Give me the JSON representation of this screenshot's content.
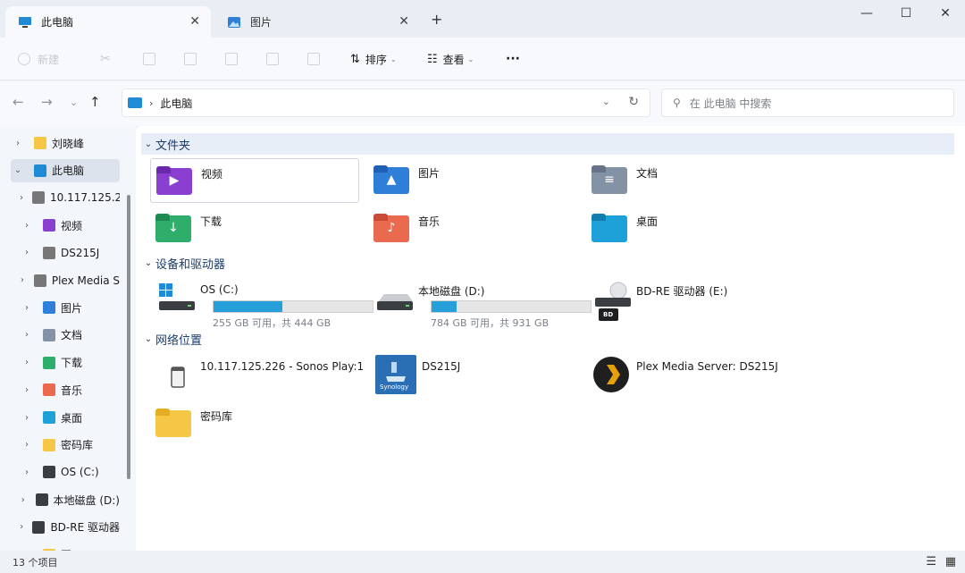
{
  "tabs": [
    {
      "label": "此电脑",
      "close": "✕"
    },
    {
      "label": "图片",
      "close": "✕"
    }
  ],
  "new_tab": "+",
  "window_controls": {
    "minimize": "—",
    "maximize": "☐",
    "close": "✕"
  },
  "toolbar": {
    "new_label": "新建",
    "sort_label": "排序",
    "view_label": "查看",
    "more_label": "···"
  },
  "address": {
    "path": "此电脑",
    "search_placeholder": "在 此电脑 中搜索"
  },
  "sidebar": {
    "items": [
      {
        "label": "刘晓峰",
        "icon": "folder-icon"
      },
      {
        "label": "此电脑",
        "icon": "pc-icon"
      },
      {
        "label": "10.117.125.2",
        "icon": "network-device-icon"
      },
      {
        "label": "视频",
        "icon": "video-icon"
      },
      {
        "label": "DS215J",
        "icon": "nas-icon"
      },
      {
        "label": "Plex Media S",
        "icon": "media-server-icon"
      },
      {
        "label": "图片",
        "icon": "pictures-icon"
      },
      {
        "label": "文档",
        "icon": "documents-icon"
      },
      {
        "label": "下载",
        "icon": "download-icon"
      },
      {
        "label": "音乐",
        "icon": "music-icon"
      },
      {
        "label": "桌面",
        "icon": "desktop-icon"
      },
      {
        "label": "密码库",
        "icon": "folder-icon"
      },
      {
        "label": "OS (C:)",
        "icon": "drive-c-icon"
      },
      {
        "label": "本地磁盘 (D:)",
        "icon": "drive-icon"
      },
      {
        "label": "BD-RE 驱动器",
        "icon": "optical-drive-icon"
      },
      {
        "label": "网",
        "icon": "network-icon"
      }
    ]
  },
  "sections": {
    "folders": {
      "title": "文件夹",
      "items": [
        {
          "label": "视频",
          "icon": "video-folder-icon"
        },
        {
          "label": "图片",
          "icon": "pictures-folder-icon"
        },
        {
          "label": "文档",
          "icon": "documents-folder-icon"
        },
        {
          "label": "下载",
          "icon": "downloads-folder-icon"
        },
        {
          "label": "音乐",
          "icon": "music-folder-icon"
        },
        {
          "label": "桌面",
          "icon": "desktop-folder-icon"
        }
      ]
    },
    "devices": {
      "title": "设备和驱动器",
      "items": [
        {
          "label": "OS (C:)",
          "sub": "255 GB 可用，共 444 GB",
          "used_fraction": 0.43
        },
        {
          "label": "本地磁盘 (D:)",
          "sub": "784 GB 可用，共 931 GB",
          "used_fraction": 0.16
        },
        {
          "label": "BD-RE 驱动器 (E:)",
          "badge": "BD"
        }
      ]
    },
    "network": {
      "title": "网络位置",
      "items": [
        {
          "label": "10.117.125.226 - Sonos Play:1",
          "icon": "speaker-icon"
        },
        {
          "label": "DS215J",
          "icon": "synology-icon",
          "badge": "Synology"
        },
        {
          "label": "Plex Media Server: DS215J",
          "icon": "plex-icon"
        },
        {
          "label": "密码库",
          "icon": "folder-icon"
        }
      ]
    }
  },
  "status": {
    "count": "13 个项目"
  },
  "colors": {
    "accent": "#26a0da",
    "folder_yellow": "#f6c744",
    "video_purple": "#8a3fd1",
    "pictures_blue": "#2f7fd8",
    "downloads_green": "#2fae6b",
    "music_orange": "#ea6a4f",
    "desktop_cyan": "#1da1d8",
    "documents_gray": "#7f8ea3"
  }
}
